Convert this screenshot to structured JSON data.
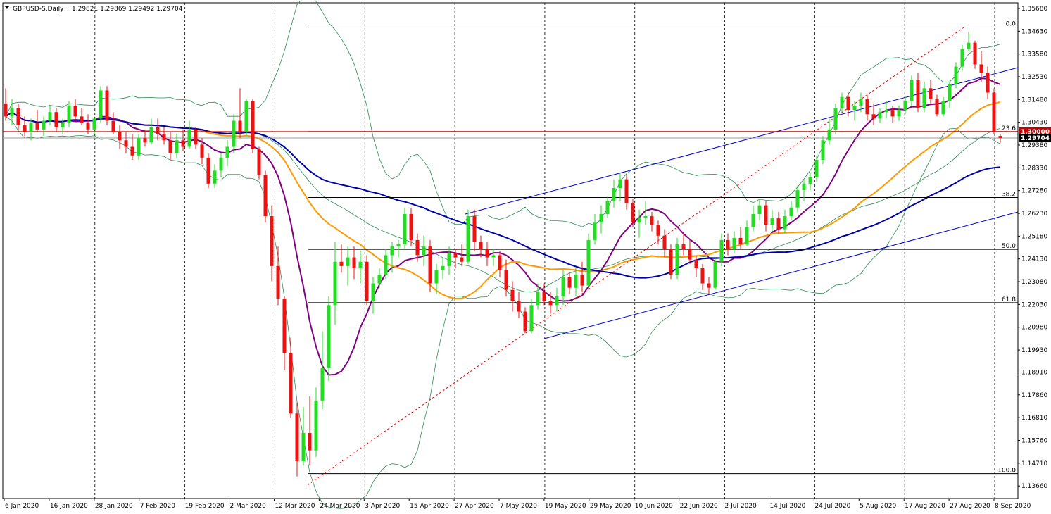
{
  "header": {
    "symbol_label": "GBPUSD-S,Daily",
    "ohlc": "1.29821 1.29869 1.29492 1.29704"
  },
  "chart_data": {
    "type": "candlestick",
    "title": "GBPUSD-S,Daily",
    "ylim": [
      1.3626,
      1.3626
    ],
    "y_range": [
      1.13665,
      1.3568
    ],
    "y_ticks": [
      "1.35680",
      "1.34630",
      "1.33580",
      "1.32530",
      "1.31480",
      "1.30430",
      "1.29380",
      "1.28330",
      "1.27280",
      "1.26230",
      "1.25180",
      "1.24130",
      "1.23080",
      "1.22030",
      "1.20980",
      "1.19930",
      "1.18910",
      "1.17860",
      "1.16810",
      "1.15760",
      "1.14710",
      "1.13660"
    ],
    "x_ticks": [
      "6 Jan 2020",
      "16 Jan 2020",
      "28 Jan 2020",
      "7 Feb 2020",
      "19 Feb 2020",
      "2 Mar 2020",
      "12 Mar 2020",
      "24 Mar 2020",
      "3 Apr 2020",
      "15 Apr 2020",
      "27 Apr 2020",
      "7 May 2020",
      "19 May 2020",
      "29 May 2020",
      "10 Jun 2020",
      "22 Jun 2020",
      "2 Jul 2020",
      "14 Jul 2020",
      "24 Jul 2020",
      "5 Aug 2020",
      "17 Aug 2020",
      "27 Aug 2020",
      "8 Sep 2020"
    ],
    "price_tags": [
      {
        "label": "1.30000",
        "value": 1.3,
        "color": "#cc0000"
      },
      {
        "label": "1.29704",
        "value": 1.29704,
        "color": "#000000"
      }
    ],
    "fibonacci": [
      {
        "label": "0.0",
        "value": 1.3482
      },
      {
        "label": "23.6",
        "value": 1.3
      },
      {
        "label": "38.2",
        "value": 1.2696
      },
      {
        "label": "50.0",
        "value": 1.2457
      },
      {
        "label": "61.8",
        "value": 1.2211
      },
      {
        "label": "100.0",
        "value": 1.1423
      }
    ],
    "candles": [
      [
        1.313,
        1.32,
        1.305,
        1.307
      ],
      [
        1.307,
        1.315,
        1.303,
        1.311
      ],
      [
        1.311,
        1.313,
        1.301,
        1.303
      ],
      [
        1.303,
        1.307,
        1.298,
        1.3
      ],
      [
        1.3,
        1.306,
        1.296,
        1.304
      ],
      [
        1.304,
        1.31,
        1.3,
        1.301
      ],
      [
        1.301,
        1.307,
        1.298,
        1.305
      ],
      [
        1.305,
        1.312,
        1.303,
        1.309
      ],
      [
        1.309,
        1.311,
        1.3,
        1.302
      ],
      [
        1.302,
        1.306,
        1.299,
        1.304
      ],
      [
        1.304,
        1.314,
        1.302,
        1.312
      ],
      [
        1.312,
        1.315,
        1.305,
        1.307
      ],
      [
        1.307,
        1.311,
        1.303,
        1.304
      ],
      [
        1.304,
        1.308,
        1.299,
        1.301
      ],
      [
        1.301,
        1.307,
        1.298,
        1.306
      ],
      [
        1.306,
        1.321,
        1.304,
        1.319
      ],
      [
        1.319,
        1.321,
        1.303,
        1.305
      ],
      [
        1.305,
        1.309,
        1.299,
        1.3
      ],
      [
        1.3,
        1.303,
        1.292,
        1.296
      ],
      [
        1.296,
        1.3,
        1.29,
        1.293
      ],
      [
        1.293,
        1.299,
        1.287,
        1.289
      ],
      [
        1.289,
        1.299,
        1.287,
        1.297
      ],
      [
        1.297,
        1.301,
        1.293,
        1.295
      ],
      [
        1.295,
        1.306,
        1.294,
        1.302
      ],
      [
        1.302,
        1.306,
        1.296,
        1.299
      ],
      [
        1.299,
        1.302,
        1.294,
        1.296
      ],
      [
        1.296,
        1.3,
        1.287,
        1.29
      ],
      [
        1.29,
        1.299,
        1.288,
        1.296
      ],
      [
        1.296,
        1.301,
        1.291,
        1.293
      ],
      [
        1.293,
        1.305,
        1.292,
        1.301
      ],
      [
        1.301,
        1.302,
        1.292,
        1.294
      ],
      [
        1.294,
        1.297,
        1.285,
        1.288
      ],
      [
        1.288,
        1.29,
        1.274,
        1.276
      ],
      [
        1.276,
        1.285,
        1.274,
        1.282
      ],
      [
        1.282,
        1.29,
        1.279,
        1.288
      ],
      [
        1.288,
        1.296,
        1.284,
        1.293
      ],
      [
        1.293,
        1.308,
        1.29,
        1.305
      ],
      [
        1.305,
        1.32,
        1.297,
        1.3
      ],
      [
        1.3,
        1.315,
        1.298,
        1.314
      ],
      [
        1.314,
        1.315,
        1.29,
        1.292
      ],
      [
        1.292,
        1.293,
        1.278,
        1.28
      ],
      [
        1.28,
        1.282,
        1.258,
        1.261
      ],
      [
        1.261,
        1.266,
        1.231,
        1.238
      ],
      [
        1.238,
        1.247,
        1.22,
        1.223
      ],
      [
        1.223,
        1.224,
        1.19,
        1.198
      ],
      [
        1.198,
        1.205,
        1.168,
        1.17
      ],
      [
        1.17,
        1.175,
        1.141,
        1.148
      ],
      [
        1.148,
        1.173,
        1.146,
        1.161
      ],
      [
        1.161,
        1.178,
        1.146,
        1.153
      ],
      [
        1.153,
        1.182,
        1.15,
        1.176
      ],
      [
        1.176,
        1.208,
        1.172,
        1.191
      ],
      [
        1.191,
        1.224,
        1.185,
        1.22
      ],
      [
        1.22,
        1.249,
        1.211,
        1.24
      ],
      [
        1.24,
        1.248,
        1.235,
        1.238
      ],
      [
        1.238,
        1.247,
        1.229,
        1.242
      ],
      [
        1.242,
        1.247,
        1.232,
        1.237
      ],
      [
        1.237,
        1.245,
        1.23,
        1.24
      ],
      [
        1.24,
        1.243,
        1.22,
        1.222
      ],
      [
        1.222,
        1.233,
        1.216,
        1.23
      ],
      [
        1.23,
        1.237,
        1.228,
        1.234
      ],
      [
        1.234,
        1.246,
        1.232,
        1.243
      ],
      [
        1.243,
        1.249,
        1.235,
        1.247
      ],
      [
        1.247,
        1.25,
        1.242,
        1.248
      ],
      [
        1.248,
        1.265,
        1.246,
        1.262
      ],
      [
        1.262,
        1.265,
        1.247,
        1.25
      ],
      [
        1.25,
        1.253,
        1.24,
        1.243
      ],
      [
        1.243,
        1.252,
        1.238,
        1.247
      ],
      [
        1.247,
        1.25,
        1.226,
        1.23
      ],
      [
        1.23,
        1.239,
        1.225,
        1.236
      ],
      [
        1.236,
        1.242,
        1.232,
        1.238
      ],
      [
        1.238,
        1.247,
        1.234,
        1.244
      ],
      [
        1.244,
        1.246,
        1.237,
        1.242
      ],
      [
        1.242,
        1.248,
        1.238,
        1.24
      ],
      [
        1.24,
        1.264,
        1.239,
        1.261
      ],
      [
        1.261,
        1.264,
        1.245,
        1.249
      ],
      [
        1.249,
        1.252,
        1.242,
        1.246
      ],
      [
        1.246,
        1.249,
        1.238,
        1.242
      ],
      [
        1.242,
        1.246,
        1.238,
        1.243
      ],
      [
        1.243,
        1.245,
        1.233,
        1.236
      ],
      [
        1.236,
        1.241,
        1.224,
        1.227
      ],
      [
        1.227,
        1.231,
        1.217,
        1.222
      ],
      [
        1.222,
        1.226,
        1.214,
        1.217
      ],
      [
        1.217,
        1.219,
        1.207,
        1.208
      ],
      [
        1.208,
        1.223,
        1.207,
        1.22
      ],
      [
        1.22,
        1.23,
        1.218,
        1.226
      ],
      [
        1.226,
        1.23,
        1.22,
        1.222
      ],
      [
        1.222,
        1.226,
        1.216,
        1.22
      ],
      [
        1.22,
        1.228,
        1.217,
        1.224
      ],
      [
        1.224,
        1.236,
        1.22,
        1.233
      ],
      [
        1.233,
        1.235,
        1.225,
        1.228
      ],
      [
        1.228,
        1.237,
        1.224,
        1.234
      ],
      [
        1.234,
        1.24,
        1.226,
        1.229
      ],
      [
        1.229,
        1.253,
        1.228,
        1.25
      ],
      [
        1.25,
        1.262,
        1.248,
        1.258
      ],
      [
        1.258,
        1.266,
        1.253,
        1.262
      ],
      [
        1.262,
        1.27,
        1.26,
        1.268
      ],
      [
        1.268,
        1.278,
        1.265,
        1.274
      ],
      [
        1.274,
        1.281,
        1.268,
        1.278
      ],
      [
        1.278,
        1.28,
        1.264,
        1.267
      ],
      [
        1.267,
        1.269,
        1.256,
        1.258
      ],
      [
        1.258,
        1.264,
        1.251,
        1.26
      ],
      [
        1.26,
        1.268,
        1.257,
        1.261
      ],
      [
        1.261,
        1.263,
        1.254,
        1.257
      ],
      [
        1.257,
        1.259,
        1.248,
        1.252
      ],
      [
        1.252,
        1.255,
        1.242,
        1.246
      ],
      [
        1.246,
        1.248,
        1.232,
        1.234
      ],
      [
        1.234,
        1.251,
        1.232,
        1.248
      ],
      [
        1.248,
        1.253,
        1.243,
        1.246
      ],
      [
        1.246,
        1.25,
        1.239,
        1.241
      ],
      [
        1.241,
        1.243,
        1.233,
        1.237
      ],
      [
        1.237,
        1.239,
        1.227,
        1.23
      ],
      [
        1.23,
        1.233,
        1.225,
        1.228
      ],
      [
        1.228,
        1.242,
        1.227,
        1.24
      ],
      [
        1.24,
        1.253,
        1.238,
        1.25
      ],
      [
        1.25,
        1.253,
        1.243,
        1.246
      ],
      [
        1.246,
        1.254,
        1.244,
        1.251
      ],
      [
        1.251,
        1.256,
        1.246,
        1.248
      ],
      [
        1.248,
        1.259,
        1.247,
        1.256
      ],
      [
        1.256,
        1.266,
        1.254,
        1.262
      ],
      [
        1.262,
        1.269,
        1.259,
        1.266
      ],
      [
        1.266,
        1.268,
        1.254,
        1.257
      ],
      [
        1.257,
        1.264,
        1.254,
        1.26
      ],
      [
        1.26,
        1.263,
        1.253,
        1.255
      ],
      [
        1.255,
        1.264,
        1.253,
        1.261
      ],
      [
        1.261,
        1.268,
        1.259,
        1.265
      ],
      [
        1.265,
        1.275,
        1.263,
        1.273
      ],
      [
        1.273,
        1.278,
        1.268,
        1.276
      ],
      [
        1.276,
        1.281,
        1.273,
        1.279
      ],
      [
        1.279,
        1.289,
        1.277,
        1.287
      ],
      [
        1.287,
        1.298,
        1.285,
        1.296
      ],
      [
        1.296,
        1.306,
        1.294,
        1.301
      ],
      [
        1.301,
        1.313,
        1.299,
        1.311
      ],
      [
        1.311,
        1.318,
        1.309,
        1.316
      ],
      [
        1.316,
        1.318,
        1.307,
        1.31
      ],
      [
        1.31,
        1.314,
        1.305,
        1.312
      ],
      [
        1.312,
        1.318,
        1.309,
        1.315
      ],
      [
        1.315,
        1.317,
        1.305,
        1.308
      ],
      [
        1.308,
        1.313,
        1.303,
        1.306
      ],
      [
        1.306,
        1.311,
        1.304,
        1.309
      ],
      [
        1.309,
        1.314,
        1.306,
        1.31
      ],
      [
        1.31,
        1.312,
        1.304,
        1.307
      ],
      [
        1.307,
        1.312,
        1.305,
        1.31
      ],
      [
        1.31,
        1.316,
        1.308,
        1.314
      ],
      [
        1.314,
        1.326,
        1.312,
        1.324
      ],
      [
        1.324,
        1.327,
        1.309,
        1.311
      ],
      [
        1.311,
        1.323,
        1.309,
        1.32
      ],
      [
        1.32,
        1.324,
        1.313,
        1.315
      ],
      [
        1.315,
        1.317,
        1.307,
        1.308
      ],
      [
        1.308,
        1.316,
        1.307,
        1.314
      ],
      [
        1.314,
        1.323,
        1.311,
        1.322
      ],
      [
        1.322,
        1.332,
        1.32,
        1.33
      ],
      [
        1.33,
        1.34,
        1.328,
        1.338
      ],
      [
        1.338,
        1.346,
        1.337,
        1.341
      ],
      [
        1.341,
        1.342,
        1.329,
        1.331
      ],
      [
        1.331,
        1.337,
        1.323,
        1.327
      ],
      [
        1.327,
        1.33,
        1.315,
        1.318
      ],
      [
        1.318,
        1.32,
        1.299,
        1.3
      ],
      [
        1.298,
        1.2987,
        1.2949,
        1.297
      ]
    ],
    "candle_pixel_anchor": null
  }
}
